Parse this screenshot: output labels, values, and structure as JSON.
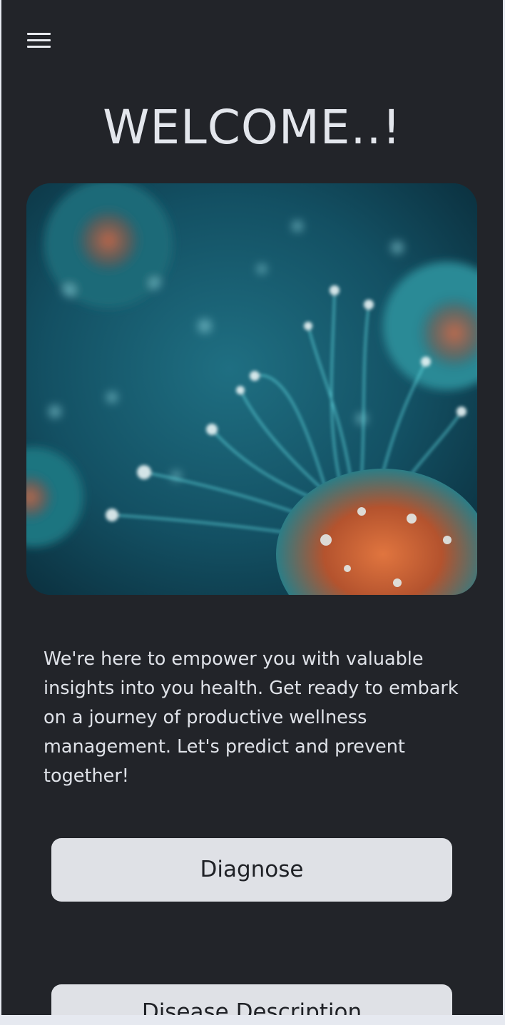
{
  "header": {
    "menu_icon": "hamburger-menu-icon",
    "title": "WELCOME..!"
  },
  "hero": {
    "image_kind": "illustration",
    "icon": "virus-cell-image"
  },
  "intro": {
    "text": "We're here to empower you with valuable insights into you health. Get ready to embark on a journey of productive wellness management. Let's predict and prevent together!"
  },
  "actions": {
    "diagnose_label": "Diagnose",
    "description_label": "Disease Description"
  },
  "colors": {
    "background": "#222429",
    "text": "#e3e6ec",
    "button_bg": "#dfe1e6",
    "button_text": "#1f2126"
  }
}
